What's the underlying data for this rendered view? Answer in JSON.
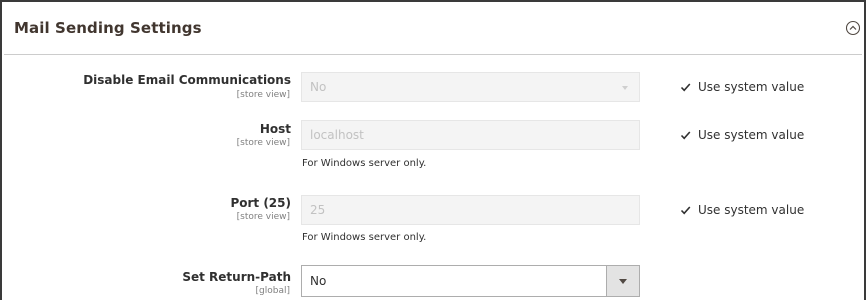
{
  "section": {
    "title": "Mail Sending Settings"
  },
  "rows": [
    {
      "label": "Disable Email Communications",
      "scope": "[store view]",
      "value": "No",
      "use_system_value": "Use system value"
    },
    {
      "label": "Host",
      "scope": "[store view]",
      "value": "localhost",
      "note": "For Windows server only.",
      "use_system_value": "Use system value"
    },
    {
      "label": "Port (25)",
      "scope": "[store view]",
      "value": "25",
      "note": "For Windows server only.",
      "use_system_value": "Use system value"
    },
    {
      "label": "Set Return-Path",
      "scope": "[global]",
      "value": "No"
    }
  ]
}
